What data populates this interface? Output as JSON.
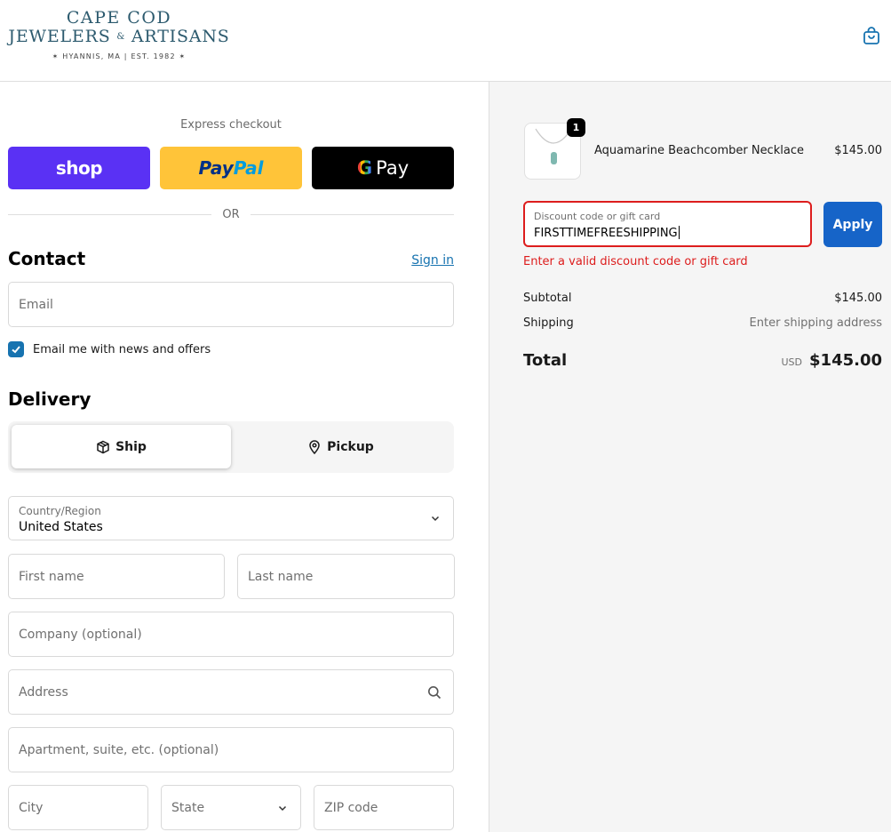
{
  "header": {
    "logo_line1": "CAPE COD",
    "logo_line2_a": "JEWELERS",
    "logo_line2_amp": "&",
    "logo_line2_b": "ARTISANS",
    "logo_line3": "✶ HYANNIS, MA | EST. 1982 ✶",
    "cart_icon": "shopping-bag-icon"
  },
  "express": {
    "label": "Express checkout",
    "shop_label": "shop",
    "paypal_a": "Pay",
    "paypal_b": "Pal",
    "gpay_g": "G",
    "gpay_label": "Pay",
    "or_label": "OR"
  },
  "contact": {
    "title": "Contact",
    "sign_in": "Sign in",
    "email_placeholder": "Email",
    "newsletter_label": "Email me with news and offers",
    "newsletter_checked": true
  },
  "delivery": {
    "title": "Delivery",
    "ship_label": "Ship",
    "pickup_label": "Pickup",
    "country_label": "Country/Region",
    "country_value": "United States",
    "first_name": "First name",
    "last_name": "Last name",
    "company": "Company (optional)",
    "address": "Address",
    "apartment": "Apartment, suite, etc. (optional)",
    "city": "City",
    "state": "State",
    "zip": "ZIP code"
  },
  "summary": {
    "quantity": "1",
    "product_name": "Aquamarine Beachcomber Necklace",
    "product_price": "$145.00",
    "discount_label": "Discount code or gift card",
    "discount_value": "FIRSTTIMEFREESHIPPING",
    "apply_label": "Apply",
    "error": "Enter a valid discount code or gift card",
    "subtotal_label": "Subtotal",
    "subtotal_value": "$145.00",
    "shipping_label": "Shipping",
    "shipping_value": "Enter shipping address",
    "total_label": "Total",
    "currency": "USD",
    "total_value": "$145.00"
  },
  "colors": {
    "accent": "#1773b0",
    "shop_purple": "#5a31f4",
    "paypal_yellow": "#ffc439",
    "error_red": "#dd1d1d",
    "apply_blue": "#1664c8"
  }
}
